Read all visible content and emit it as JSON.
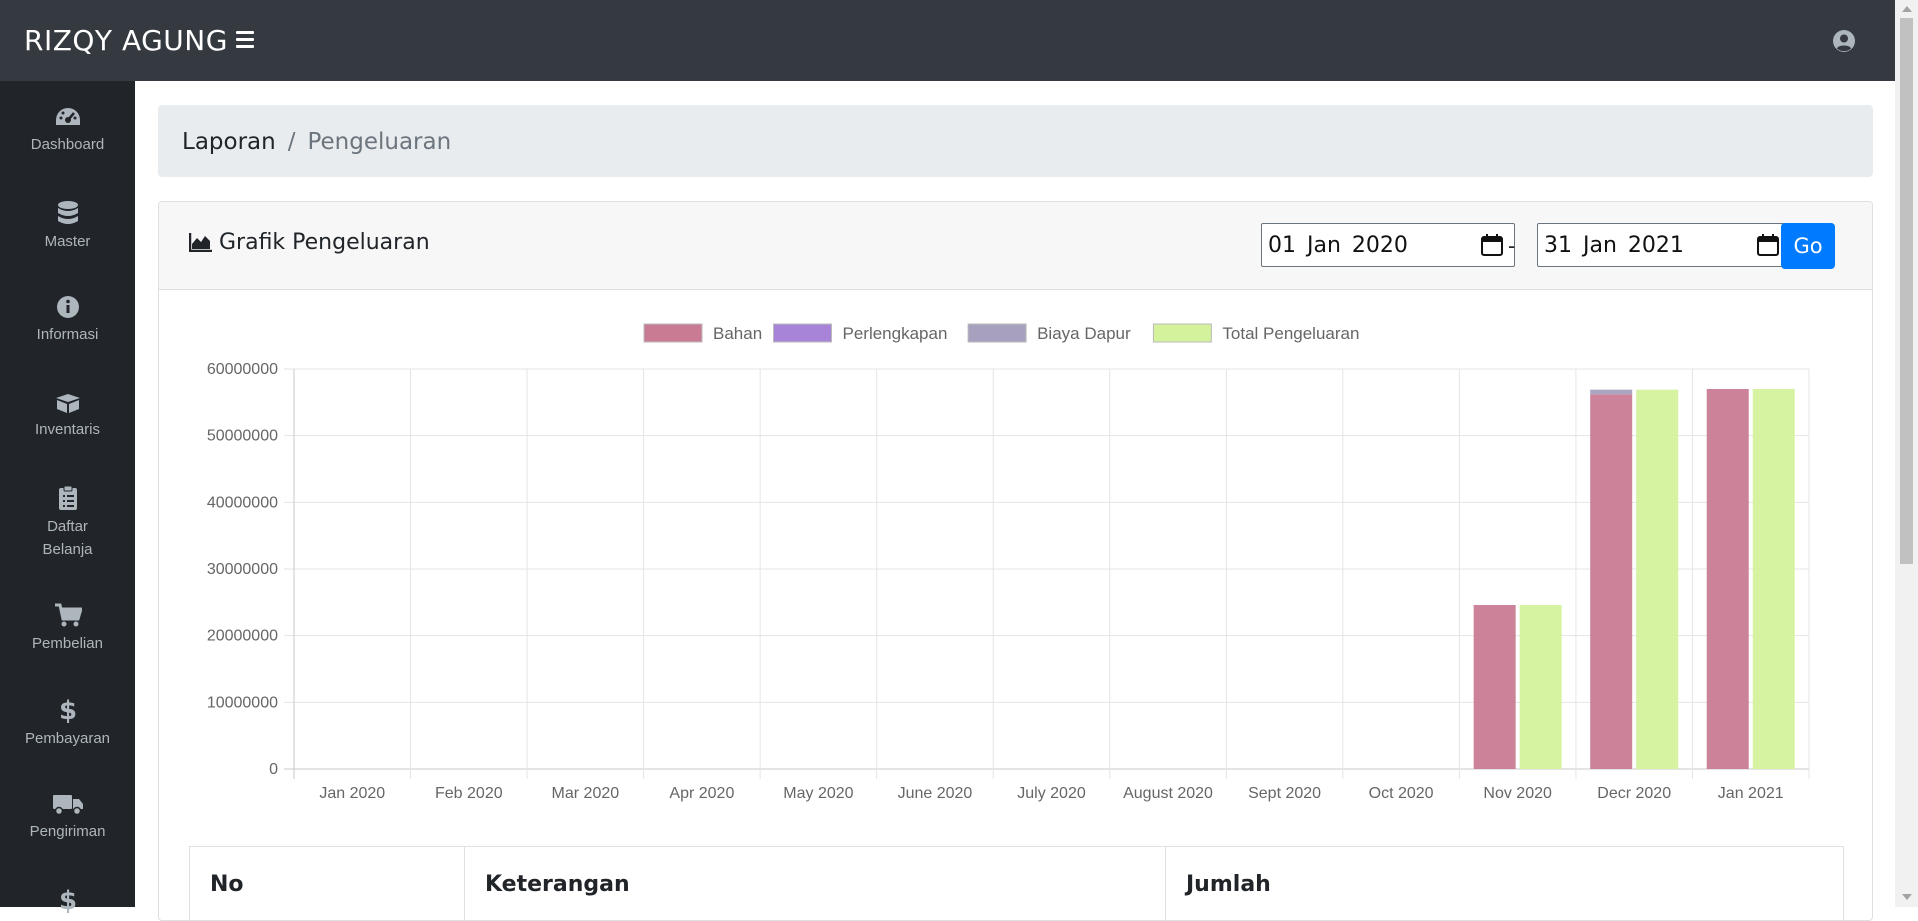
{
  "app": {
    "brand": "RIZQY AGUNG"
  },
  "sidebar": {
    "items": [
      {
        "label": "Dashboard",
        "icon": "dashboard-icon"
      },
      {
        "label": "Master",
        "icon": "database-icon"
      },
      {
        "label": "Informasi",
        "icon": "info-icon"
      },
      {
        "label": "Inventaris",
        "icon": "box-icon"
      },
      {
        "label": "Daftar Belanja",
        "icon": "clipboard-icon"
      },
      {
        "label": "Pembelian",
        "icon": "cart-icon"
      },
      {
        "label": "Pembayaran",
        "icon": "dollar-icon"
      },
      {
        "label": "Pengiriman",
        "icon": "truck-icon"
      },
      {
        "label": "",
        "icon": "dollar-icon"
      }
    ]
  },
  "breadcrumb": {
    "parent": "Laporan",
    "separator": "/",
    "current": "Pengeluaran"
  },
  "card": {
    "title": "Grafik Pengeluaran",
    "date_from": "01 Jan 2020",
    "date_separator": "-",
    "date_to": "31 Jan 2021",
    "go_label": "Go"
  },
  "table": {
    "headers": [
      "No",
      "Keterangan",
      "Jumlah"
    ]
  },
  "colors": {
    "navbar": "#343a40",
    "sidebar": "#212529",
    "primary": "#007bff"
  },
  "chart_data": {
    "type": "bar",
    "stacked": true,
    "legend_position": "top",
    "grid": true,
    "ylim": [
      0,
      60000000
    ],
    "yticks": [
      "0",
      "10000000",
      "20000000",
      "30000000",
      "40000000",
      "50000000",
      "60000000"
    ],
    "categories": [
      "Jan 2020",
      "Feb 2020",
      "Mar 2020",
      "Apr 2020",
      "May 2020",
      "June 2020",
      "July 2020",
      "August 2020",
      "Sept 2020",
      "Oct 2020",
      "Nov 2020",
      "Decr 2020",
      "Jan 2021"
    ],
    "series": [
      {
        "name": "Bahan",
        "stack": "a",
        "color": "#c97b93",
        "values": [
          0,
          0,
          0,
          0,
          0,
          0,
          0,
          0,
          0,
          0,
          24600000,
          56200000,
          57000000
        ]
      },
      {
        "name": "Perlengkapan",
        "stack": "a",
        "color": "#a784d8",
        "values": [
          0,
          0,
          0,
          0,
          0,
          0,
          0,
          0,
          0,
          0,
          0,
          0,
          0
        ]
      },
      {
        "name": "Biaya Dapur",
        "stack": "a",
        "color": "#a8a0bf",
        "values": [
          0,
          0,
          0,
          0,
          0,
          0,
          0,
          0,
          0,
          0,
          0,
          700000,
          0
        ]
      },
      {
        "name": "Total Pengeluaran",
        "stack": "b",
        "color": "#d4f29c",
        "values": [
          0,
          0,
          0,
          0,
          0,
          0,
          0,
          0,
          0,
          0,
          24600000,
          56900000,
          57000000
        ]
      }
    ]
  }
}
